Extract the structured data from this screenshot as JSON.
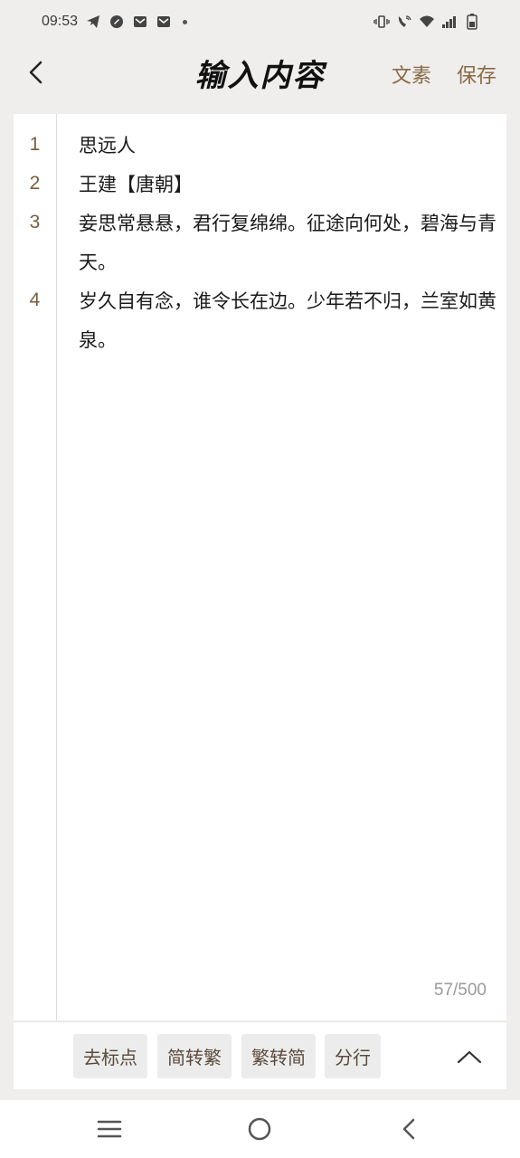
{
  "status_bar": {
    "time": "09:53",
    "left_icons": [
      "telegram-icon",
      "browser-icon",
      "mail-icon",
      "mail-icon"
    ],
    "right_icons": [
      "vibrate-icon",
      "wifi-call-icon",
      "wifi-icon",
      "signal-icon",
      "battery-icon"
    ]
  },
  "header": {
    "title": "输入内容",
    "action_wenshu": "文素",
    "action_save": "保存"
  },
  "editor": {
    "line_numbers": [
      "1",
      "2",
      "3",
      "4"
    ],
    "lines": [
      "思远人",
      "王建【唐朝】",
      "妾思常悬悬，君行复绵绵。征途向何处，碧海与青天。",
      "岁久自有念，谁令长在边。少年若不归，兰室如黄泉。"
    ],
    "char_count": "57/500"
  },
  "toolbar": {
    "remove_punct": "去标点",
    "simp_to_trad": "简转繁",
    "trad_to_simp": "繁转简",
    "split_lines": "分行"
  },
  "colors": {
    "accent": "#8a6a47",
    "background": "#efeeec",
    "surface": "#ffffff"
  }
}
